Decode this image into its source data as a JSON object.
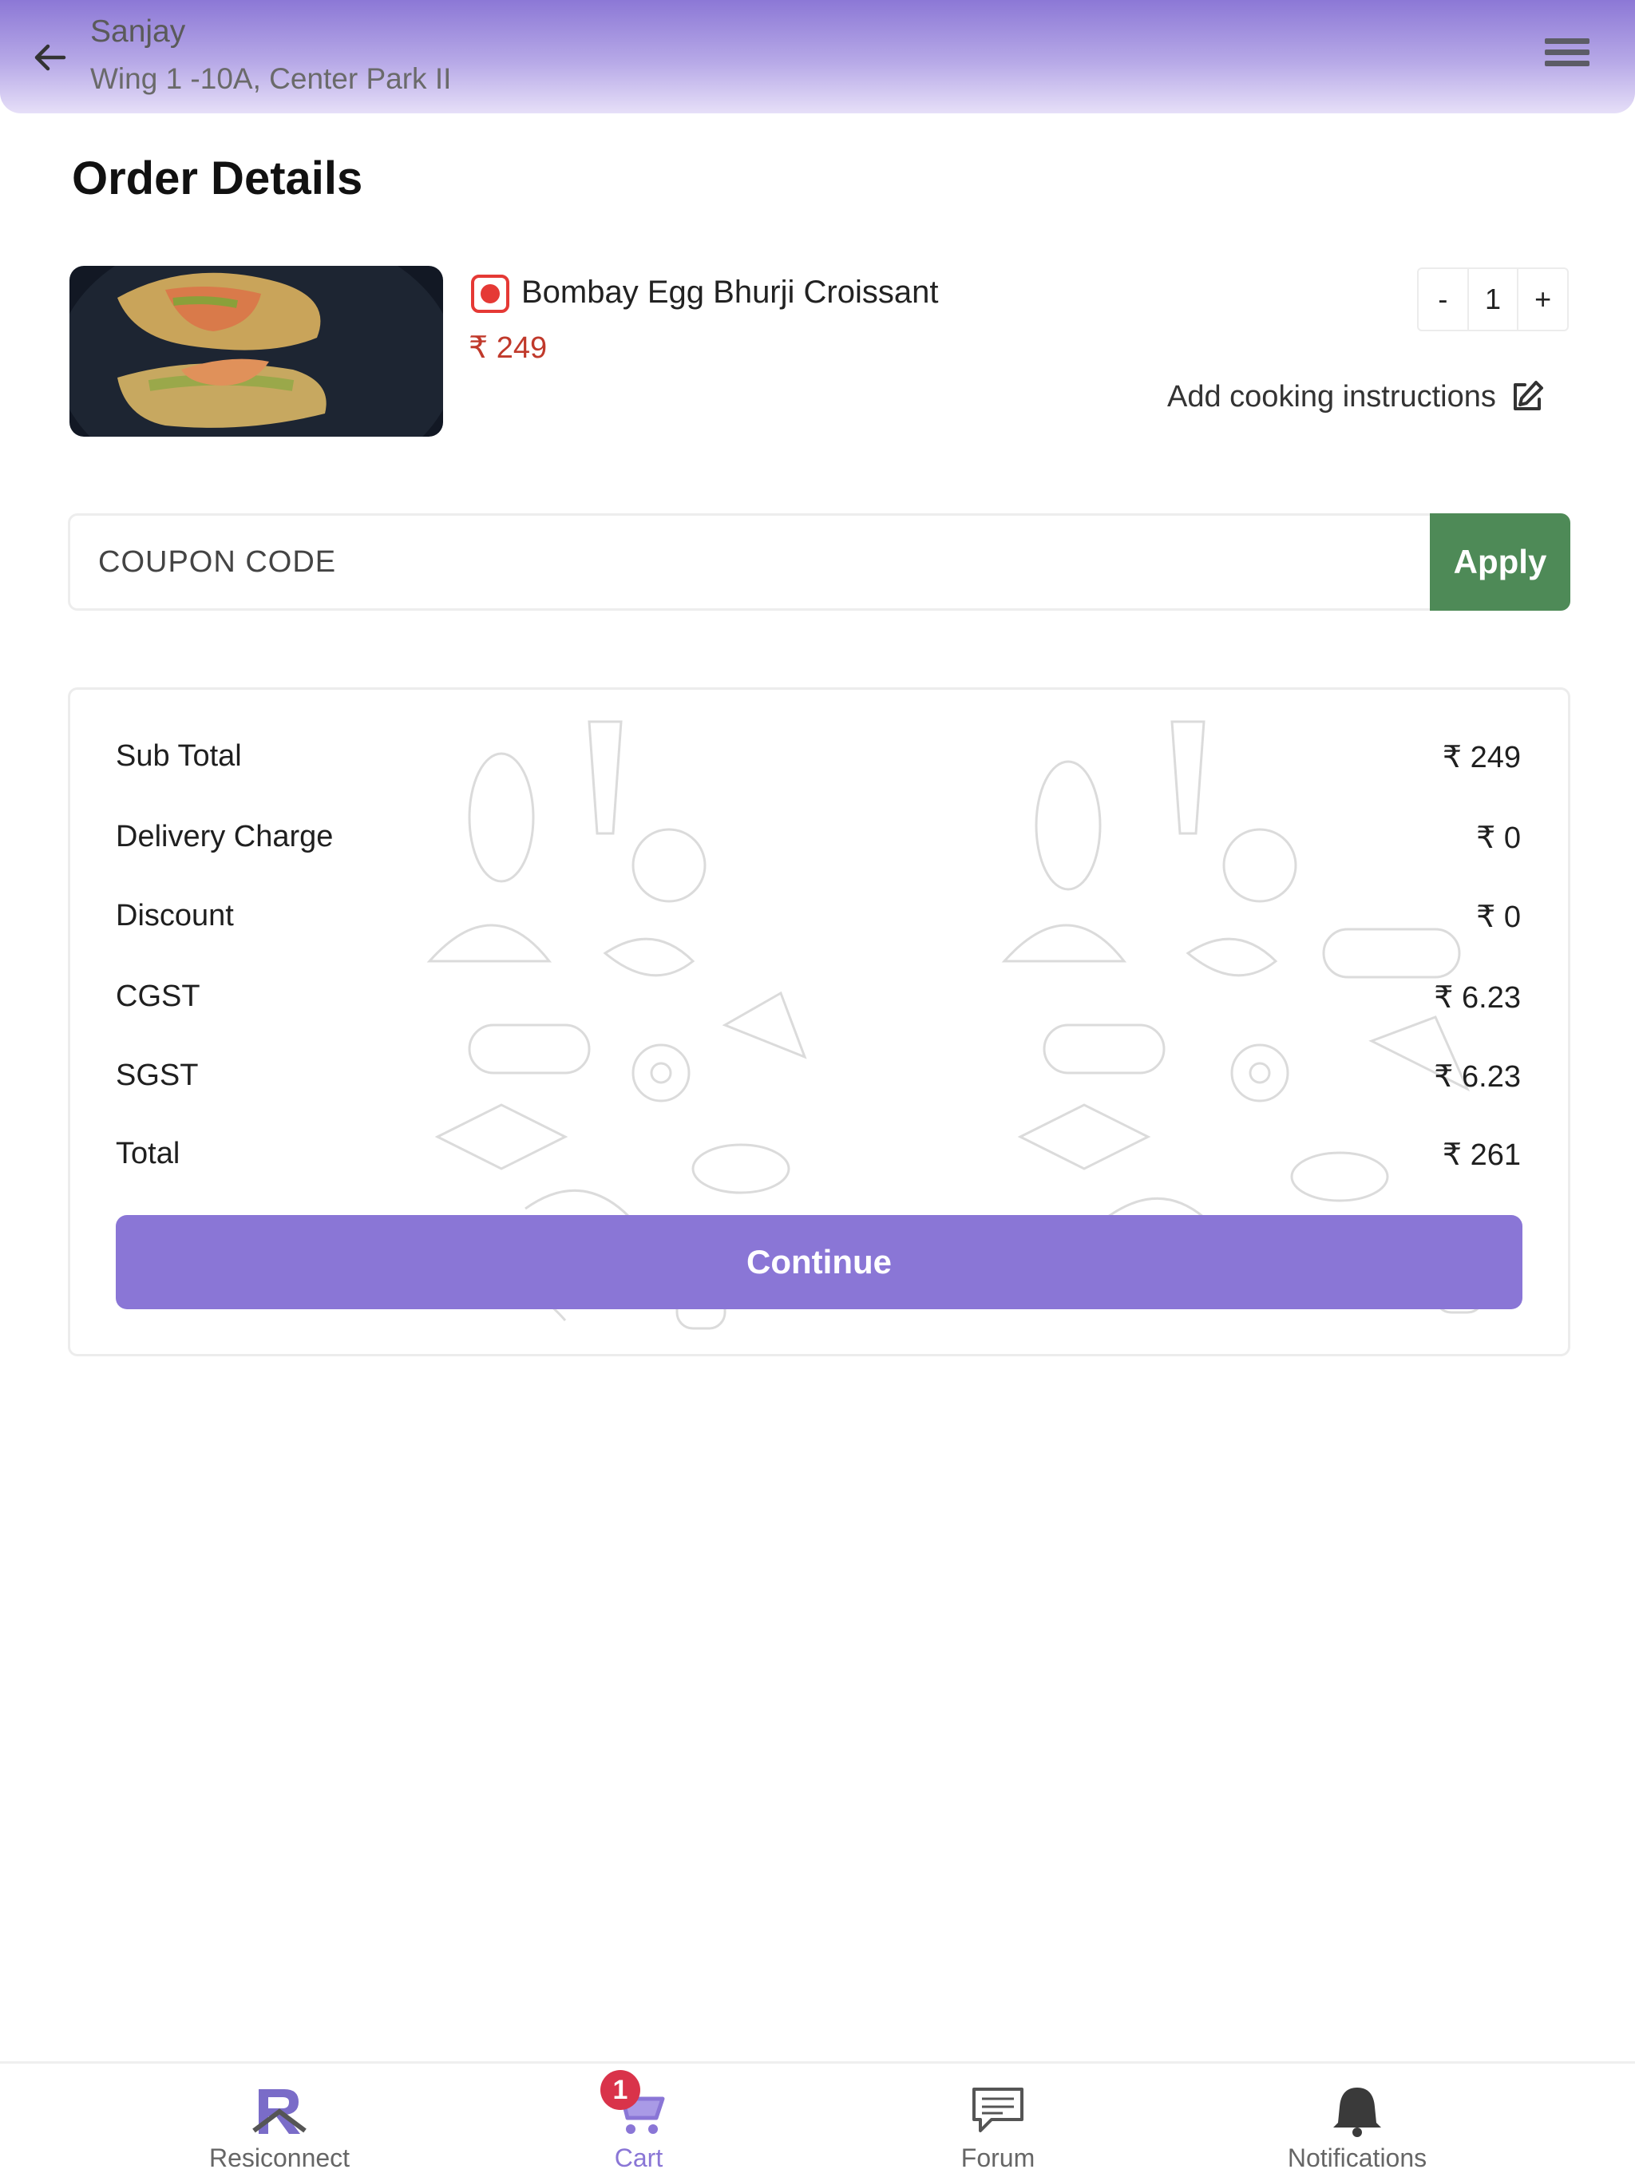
{
  "header": {
    "name": "Sanjay",
    "address": "Wing 1 -10A, Center Park II"
  },
  "page": {
    "title": "Order Details"
  },
  "cart_item": {
    "name": "Bombay Egg Bhurji Croissant",
    "price": "₹ 249",
    "quantity": "1",
    "decrement_label": "-",
    "increment_label": "+",
    "cooking_instructions_label": "Add cooking instructions",
    "veg_status_color": "#e53935"
  },
  "coupon": {
    "placeholder": "COUPON CODE",
    "value": "",
    "apply_label": "Apply"
  },
  "summary": {
    "rows": [
      {
        "label": "Sub Total",
        "value": "₹ 249"
      },
      {
        "label": "Delivery Charge",
        "value": "₹ 0"
      },
      {
        "label": "Discount",
        "value": "₹ 0"
      },
      {
        "label": "CGST",
        "value": "₹ 6.23"
      },
      {
        "label": "SGST",
        "value": "₹ 6.23"
      },
      {
        "label": "Total",
        "value": "₹ 261"
      }
    ],
    "continue_label": "Continue"
  },
  "nav": {
    "items": [
      {
        "label": "Resiconnect",
        "icon": "resiconnect-logo-icon"
      },
      {
        "label": "Cart",
        "icon": "cart-icon",
        "badge": "1"
      },
      {
        "label": "Forum",
        "icon": "chat-icon"
      },
      {
        "label": "Notifications",
        "icon": "bell-icon"
      }
    ]
  },
  "colors": {
    "accent": "#8a76d6",
    "apply_button": "#4e8a57",
    "price": "#c0392b",
    "badge": "#d9334a"
  }
}
